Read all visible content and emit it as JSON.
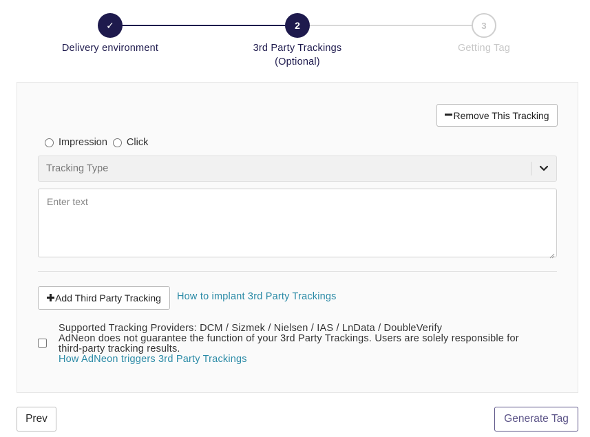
{
  "stepper": {
    "steps": [
      {
        "marker": "✓",
        "label": "Delivery environment",
        "state": "done"
      },
      {
        "marker": "2",
        "label_line1": "3rd Party Trackings",
        "label_line2": "(Optional)",
        "state": "current"
      },
      {
        "marker": "3",
        "label": "Getting Tag",
        "state": "todo"
      }
    ],
    "colors": {
      "active": "#1e1a4d",
      "inactive": "#c7c7c7"
    }
  },
  "tracking": {
    "remove_label": "Remove This Tracking",
    "remove_icon": "minus-icon",
    "radio_impression": "Impression",
    "radio_click": "Click",
    "type_placeholder": "Tracking Type",
    "text_placeholder": "Enter text"
  },
  "actions": {
    "add_label": "Add Third Party Tracking",
    "add_icon": "plus-icon",
    "implant_link": "How to implant 3rd Party Trackings"
  },
  "notice": {
    "line1": "Supported Tracking Providers: DCM / Sizmek / Nielsen / IAS / LnData / DoubleVerify",
    "line2": "AdNeon does not guarantee the function of your 3rd Party Trackings. Users are solely responsible for",
    "line3": "third-party tracking results.",
    "link": "How AdNeon triggers 3rd Party Trackings"
  },
  "footer": {
    "prev_label": "Prev",
    "generate_label": "Generate Tag"
  },
  "colors": {
    "link": "#2a8aa6",
    "primary": "#5c5488"
  }
}
